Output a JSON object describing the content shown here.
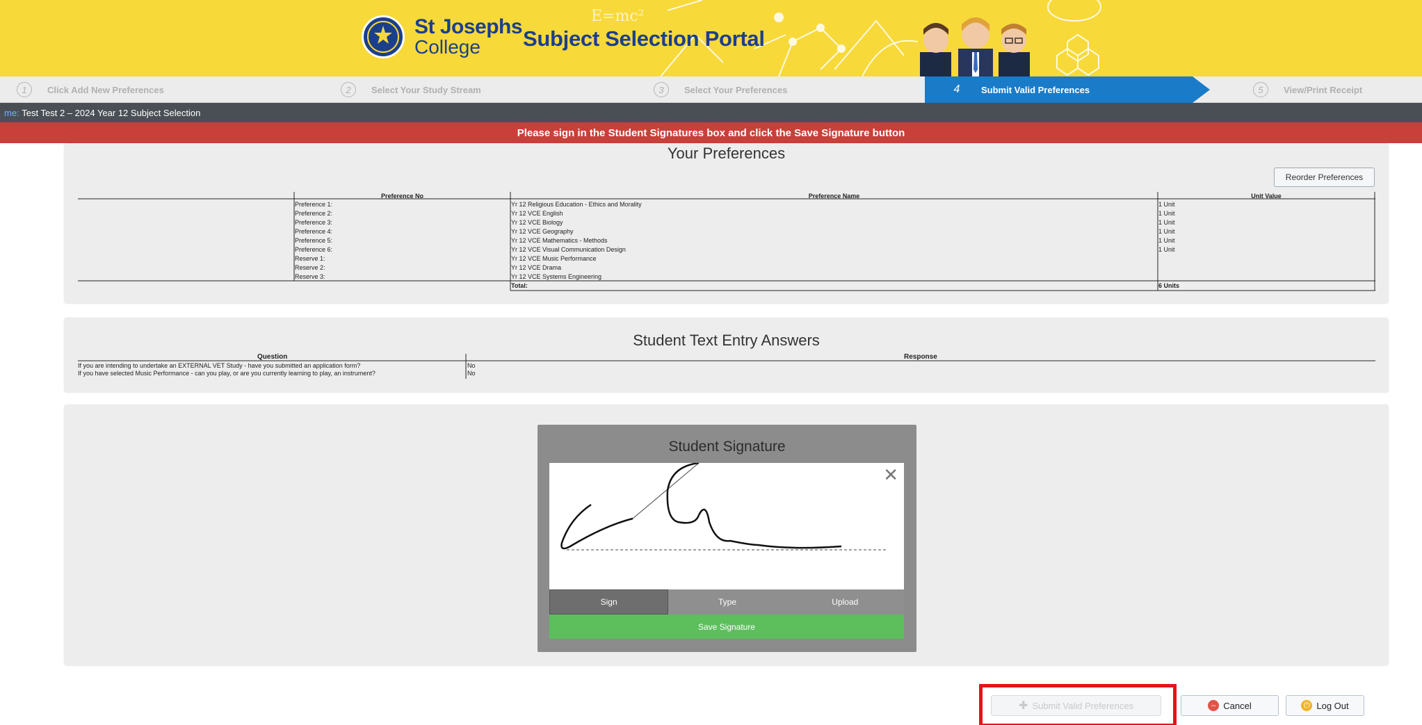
{
  "header": {
    "college_name_line1": "St Josephs",
    "college_name_line2": "College",
    "portal_title": "Subject Selection Portal"
  },
  "steps": [
    {
      "num": "1",
      "label": "Click Add New Preferences",
      "state": "inactive"
    },
    {
      "num": "2",
      "label": "Select Your Study Stream",
      "state": "inactive"
    },
    {
      "num": "3",
      "label": "Select Your Preferences",
      "state": "inactive"
    },
    {
      "num": "4",
      "label": "Submit Valid Preferences",
      "state": "active"
    },
    {
      "num": "5",
      "label": "View/Print Receipt",
      "state": "inactive"
    }
  ],
  "infobar": {
    "label": "me:",
    "text": "Test Test 2 – 2024 Year 12 Subject Selection"
  },
  "alert": "Please sign in the Student Signatures box and click the Save Signature button",
  "preferences": {
    "title": "Your Preferences",
    "reorder_label": "Reorder Preferences",
    "headers": [
      "Preference No",
      "Preference Name",
      "Unit Value"
    ],
    "rows": [
      {
        "no": "Preference 1:",
        "name": "Yr 12 Religious Education - Ethics and Morality",
        "unit": "1 Unit"
      },
      {
        "no": "Preference 2:",
        "name": "Yr 12 VCE English",
        "unit": "1 Unit"
      },
      {
        "no": "Preference 3:",
        "name": "Yr 12 VCE Biology",
        "unit": "1 Unit"
      },
      {
        "no": "Preference 4:",
        "name": "Yr 12 VCE Geography",
        "unit": "1 Unit"
      },
      {
        "no": "Preference 5:",
        "name": "Yr 12 VCE Mathematics - Methods",
        "unit": "1 Unit"
      },
      {
        "no": "Preference 6:",
        "name": "Yr 12 VCE Visual Communication Design",
        "unit": "1 Unit"
      },
      {
        "no": "Reserve 1:",
        "name": "Yr 12 VCE Music Performance",
        "unit": ""
      },
      {
        "no": "Reserve 2:",
        "name": "Yr 12 VCE Drama",
        "unit": ""
      },
      {
        "no": "Reserve 3:",
        "name": "Yr 12 VCE Systems Engineering",
        "unit": ""
      }
    ],
    "total_label": "Total:",
    "total_value": "6 Units"
  },
  "text_answers": {
    "title": "Student Text Entry Answers",
    "headers": [
      "Question",
      "Response"
    ],
    "rows": [
      {
        "q": "If you are intending to undertake an EXTERNAL VET Study - have you submitted an application form?",
        "a": "No"
      },
      {
        "q": "If you have selected Music Performance - can you play, or are you currently learning to play, an instrument?",
        "a": "No"
      }
    ]
  },
  "signature": {
    "title": "Student Signature",
    "tabs": [
      "Sign",
      "Type",
      "Upload"
    ],
    "active_tab": "Sign",
    "save_label": "Save Signature"
  },
  "buttons": {
    "submit": "Submit Valid Preferences",
    "cancel": "Cancel",
    "logout": "Log Out"
  },
  "colors": {
    "banner": "#f7d93a",
    "brand_blue": "#1c3f8c",
    "step_active": "#1a7bc9",
    "alert": "#c9403a",
    "save_green": "#5cbf5c",
    "highlight": "#e3141b"
  }
}
